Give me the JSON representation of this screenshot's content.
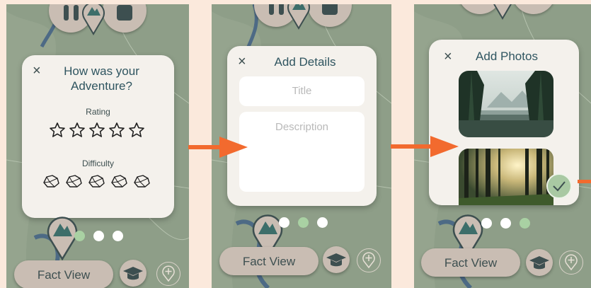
{
  "colors": {
    "background": "#fbe9dc",
    "map": "#8e9e88",
    "card": "#f4f1ec",
    "accent_arrow": "#f26a2e",
    "dot_active": "#a9d1a3",
    "button": "#c9bdb3",
    "text_dark": "#2f5560"
  },
  "screen1": {
    "close": "×",
    "title": "How was your Adventure?",
    "rating_label": "Rating",
    "difficulty_label": "Difficulty",
    "rating_value": 0,
    "rating_max": 5,
    "difficulty_value": 0,
    "difficulty_max": 5,
    "fact_view": "Fact View",
    "active_dot": 1
  },
  "screen2": {
    "close": "×",
    "title": "Add Details",
    "title_placeholder": "Title",
    "description_placeholder": "Description",
    "fact_view": "Fact View",
    "active_dot": 2
  },
  "screen3": {
    "close": "×",
    "title": "Add Photos",
    "photos": [
      "forest-lake-photo",
      "forest-sunlight-photo"
    ],
    "fact_view": "Fact View",
    "active_dot": 3
  },
  "icons": {
    "pause": "pause-icon",
    "stop": "stop-icon",
    "mountain_pin": "mountain-pin-icon",
    "graduation_cap": "graduation-cap-icon",
    "add_pin": "add-location-icon",
    "check": "check-icon",
    "star": "star-icon",
    "rock": "rock-icon",
    "arrow": "arrow-right-icon"
  }
}
